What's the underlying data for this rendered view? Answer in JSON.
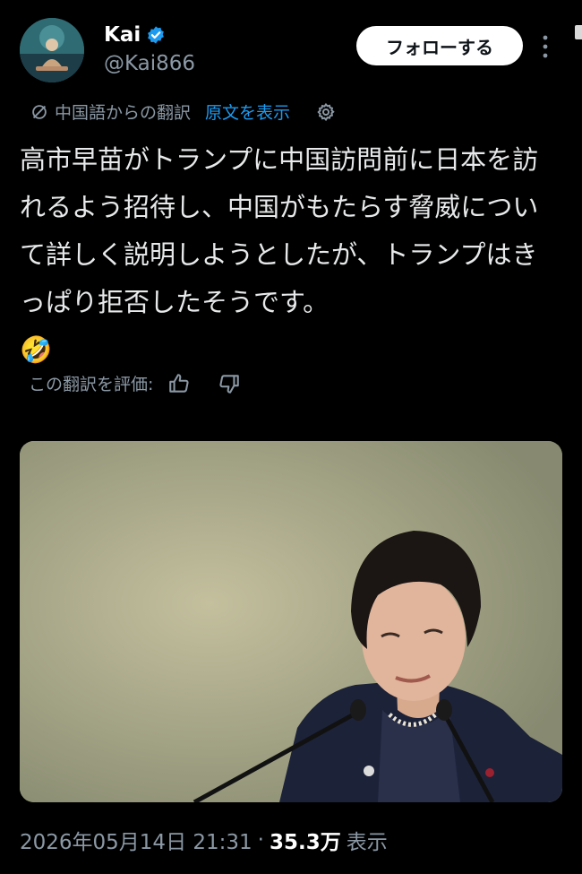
{
  "user": {
    "display_name": "Kai",
    "handle": "@Kai866",
    "verified": true,
    "verified_color": "#1d9bf0"
  },
  "header": {
    "follow_label": "フォローする",
    "more_icon": "more-vertical-icon"
  },
  "translation": {
    "icon": "translate-icon",
    "source_label": "中国語からの翻訳",
    "show_original_label": "原文を表示",
    "settings_icon": "gear-icon"
  },
  "tweet": {
    "text": "高市早苗がトランプに中国訪問前に日本を訪れるよう招待し、中国がもたらす脅威について詳しく説明しようとしたが、トランプはきっぱり拒否したそうです。\n🤣"
  },
  "rating": {
    "label": "この翻訳を評価:",
    "thumb_up_icon": "thumb-up-icon",
    "thumb_down_icon": "thumb-down-icon"
  },
  "media": {
    "type": "photo"
  },
  "footer": {
    "timestamp": "2026年05月14日 21:31",
    "separator": "·",
    "views_count": "35.3万",
    "views_label": "表示"
  },
  "colors": {
    "background": "#000000",
    "text_primary": "#e7e9ea",
    "text_secondary": "#8b98a5",
    "link": "#1d9bf0"
  }
}
